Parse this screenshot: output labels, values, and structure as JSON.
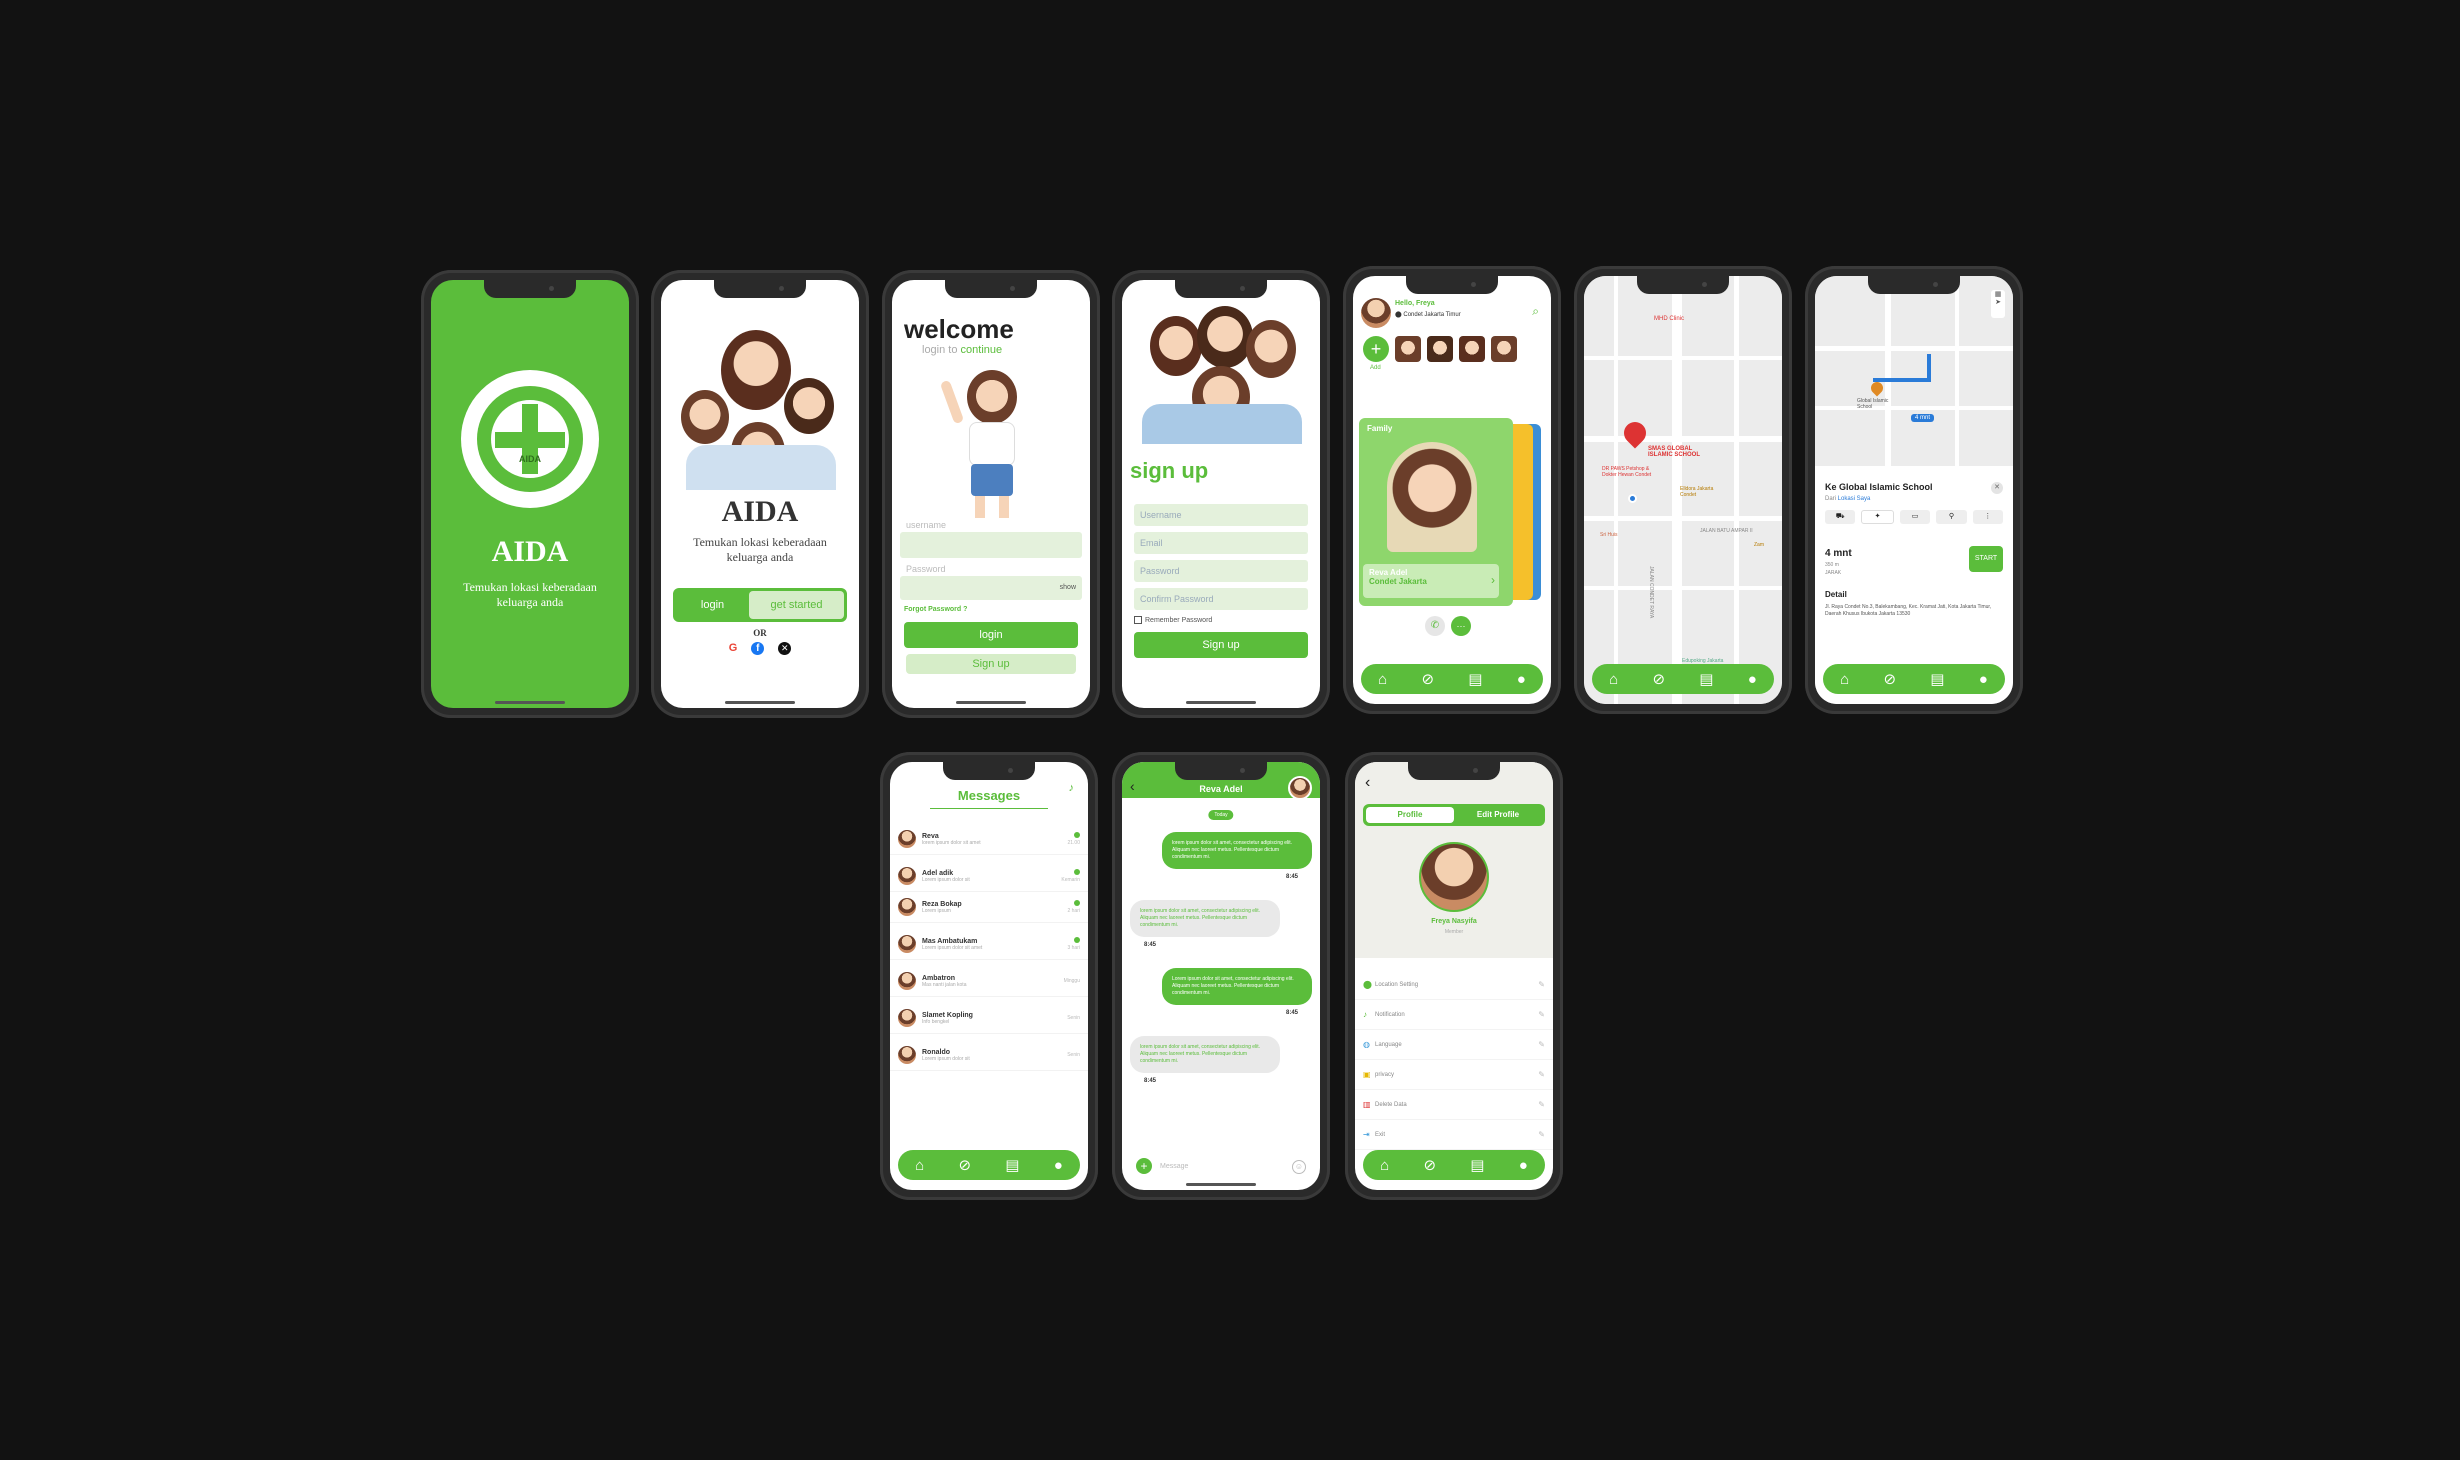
{
  "brand": {
    "name": "AIDA",
    "logo_text": "AIDA",
    "tagline": "Temukan lokasi keberadaan keluarga anda",
    "green": "#5bbd3b",
    "light_green": "#d6edc8",
    "background": "#121212"
  },
  "onboarding": {
    "title": "AIDA",
    "tagline": "Temukan lokasi keberadaan keluarga anda",
    "login_label": "login",
    "get_started_label": "get started",
    "or_label": "OR",
    "social_icons": [
      "google-icon",
      "facebook-icon",
      "x-icon"
    ]
  },
  "login": {
    "title": "welcome",
    "subtitle_prefix": "login to ",
    "subtitle_accent": "continue",
    "username_label": "username",
    "password_label": "Password",
    "show_label": "show",
    "forgot_label": "Forgot Password ?",
    "login_button": "login",
    "signup_button": "Sign up"
  },
  "signup": {
    "title": "sign up",
    "username_placeholder": "Username",
    "email_placeholder": "Email",
    "password_placeholder": "Password",
    "confirm_placeholder": "Confirm Password",
    "remember_label": "Remember Password",
    "button": "Sign up"
  },
  "home": {
    "greeting": "Hello, Freya",
    "location": "Condet Jakarta Timur",
    "add_label": "Add",
    "card_label": "Family",
    "member_name": "Reva Adel",
    "member_location": "Condet Jakarta"
  },
  "map": {
    "places": [
      "MHD Clinic",
      "SMAS GLOBAL ISLAMIC SCHOOL",
      "DR PAWS Petshop & Dokter Hewan Condet",
      "Elldora Jakarta Condet",
      "Sri Huis",
      "Zam",
      "Edupoking Jakarta"
    ],
    "streets": [
      "JALAN CONDET RAYA",
      "JALAN BATU AMPAR II"
    ]
  },
  "route": {
    "destination_pin": "Global Islamic School",
    "eta_badge": "4 mnt",
    "title": "Ke Global Islamic School",
    "from_prefix": "Dari ",
    "from_value": "Lokasi Saya",
    "duration": "4 mnt",
    "distance": "350 m",
    "mode_label": "JARAK",
    "start_label": "START",
    "detail_heading": "Detail",
    "detail_address": "Jl. Raya Condet No.3, Balekambang, Kec. Kramat Jati, Kota Jakarta Timur, Daerah Khusus Ibukota Jakarta 13530"
  },
  "messages": {
    "title": "Messages",
    "items": [
      {
        "name": "Reva",
        "preview": "lorem ipsum dolor sit amet",
        "time": "21.00"
      },
      {
        "name": "Adel adik",
        "preview": "Lorem ipsum dolor sit",
        "time": "Kemarin"
      },
      {
        "name": "Reza Bokap",
        "preview": "Lorem ipsum",
        "time": "2 hari"
      },
      {
        "name": "Mas Ambatukam",
        "preview": "Lorem ipsum dolor sit amet",
        "time": "3 hari"
      },
      {
        "name": "Ambatron",
        "preview": "Mas nanti jalan kota",
        "time": "Minggu"
      },
      {
        "name": "Slamet Kopling",
        "preview": "Info bengkel",
        "time": "Senin"
      },
      {
        "name": "Ronaldo",
        "preview": "Lorem ipsum dolor sit",
        "time": "Senin"
      }
    ]
  },
  "chat": {
    "contact": "Reva Adel",
    "day_badge": "Today",
    "messages": [
      {
        "dir": "out",
        "text": "lorem ipsum dolor sit amet, consectetur adipiscing elit. Aliquam nec laoreet metus. Pellentesque dictum condimentum mi.",
        "time": "8:45"
      },
      {
        "dir": "in",
        "text": "lorem ipsum dolor sit amet, consectetur adipiscing elit. Aliquam nec laoreet metus. Pellentesque dictum condimentum mi.",
        "time": "8:45"
      },
      {
        "dir": "out",
        "text": "Lorem ipsum dolor sit amet, consectetur adipiscing elit. Aliquam nec laoreet metus. Pellentesque dictum condimentum mi.",
        "time": "8:45"
      },
      {
        "dir": "in",
        "text": "lorem ipsum dolor sit amet, consectetur adipiscing elit. Aliquam nec laoreet metus. Pellentesque dictum condimentum mi.",
        "time": "8:45"
      }
    ],
    "input_placeholder": "Message"
  },
  "profile": {
    "tab_active": "Profile",
    "tab_other": "Edit Profile",
    "name": "Freya Nasyifa",
    "role": "Member",
    "items": [
      {
        "label": "Location Setting",
        "icon": "pin-icon"
      },
      {
        "label": "Notification",
        "icon": "bell-icon"
      },
      {
        "label": "Language",
        "icon": "globe-icon"
      },
      {
        "label": "privacy",
        "icon": "lock-icon"
      },
      {
        "label": "Delete Data",
        "icon": "trash-icon"
      },
      {
        "label": "Exit",
        "icon": "exit-icon"
      }
    ]
  }
}
